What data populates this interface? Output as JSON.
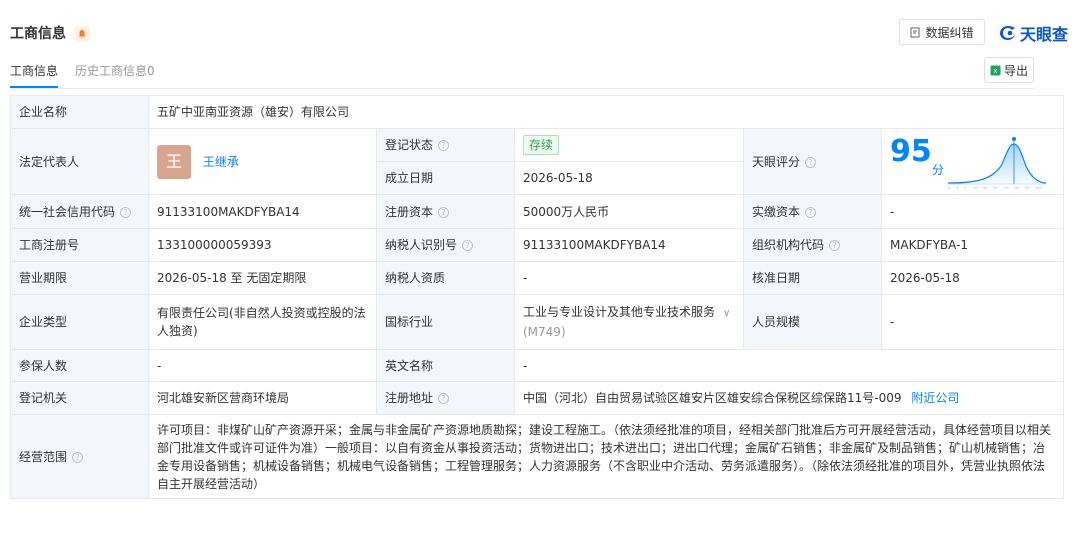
{
  "header": {
    "title": "工商信息",
    "correct_label": "数据纠错",
    "brand_label": "天眼查"
  },
  "tabs": {
    "active": "工商信息",
    "history": "历史工商信息0"
  },
  "export_label": "导出",
  "rows": {
    "company_name": {
      "label": "企业名称",
      "value": "五矿中亚南亚资源（雄安）有限公司"
    },
    "legal_rep": {
      "label": "法定代表人",
      "avatar_char": "王",
      "name": "王继承"
    },
    "reg_status": {
      "label": "登记状态",
      "value": "存续"
    },
    "establish_date": {
      "label": "成立日期",
      "value": "2026-05-18"
    },
    "score": {
      "label": "天眼评分",
      "value": "95",
      "unit": "分"
    },
    "credit_code": {
      "label": "统一社会信用代码",
      "value": "91133100MAKDFYBA14"
    },
    "reg_capital": {
      "label": "注册资本",
      "value": "50000万人民币"
    },
    "paid_capital": {
      "label": "实缴资本",
      "value": "-"
    },
    "reg_number": {
      "label": "工商注册号",
      "value": "133100000059393"
    },
    "taxpayer_id": {
      "label": "纳税人识别号",
      "value": "91133100MAKDFYBA14"
    },
    "org_code": {
      "label": "组织机构代码",
      "value": "MAKDFYBA-1"
    },
    "business_term": {
      "label": "营业期限",
      "value": "2026-05-18 至 无固定期限"
    },
    "taxpayer_qual": {
      "label": "纳税人资质",
      "value": "-"
    },
    "approval_date": {
      "label": "核准日期",
      "value": "2026-05-18"
    },
    "company_type": {
      "label": "企业类型",
      "value": "有限责任公司(非自然人投资或控股的法人独资)"
    },
    "industry": {
      "label": "国标行业",
      "value": "工业与专业设计及其他专业技术服务",
      "code": "(M749)"
    },
    "staff_size": {
      "label": "人员规模",
      "value": "-"
    },
    "insured": {
      "label": "参保人数",
      "value": "-"
    },
    "english_name": {
      "label": "英文名称",
      "value": "-"
    },
    "reg_authority": {
      "label": "登记机关",
      "value": "河北雄安新区营商环境局"
    },
    "reg_address": {
      "label": "注册地址",
      "value": "中国（河北）自由贸易试验区雄安片区雄安综合保税区综保路11号-009",
      "link": "附近公司"
    },
    "scope": {
      "label": "经营范围",
      "value": "许可项目：非煤矿山矿产资源开采；金属与非金属矿产资源地质勘探；建设工程施工。（依法须经批准的项目，经相关部门批准后方可开展经营活动，具体经营项目以相关部门批准文件或许可证件为准）一般项目：以自有资金从事投资活动；货物进出口；技术进出口；进出口代理；金属矿石销售；非金属矿及制品销售；矿山机械销售；冶金专用设备销售；机械设备销售；机械电气设备销售；工程管理服务；人力资源服务（不含职业中介活动、劳务派遣服务）。（除依法须经批准的项目外，凭营业执照依法自主开展经营活动）"
    }
  },
  "colors": {
    "accent": "#0084ff",
    "label_bg": "#f3f6fb",
    "status_green": "#2fa350",
    "avatar_bg": "#d8a68e",
    "brand_blue": "#0c56c9"
  }
}
